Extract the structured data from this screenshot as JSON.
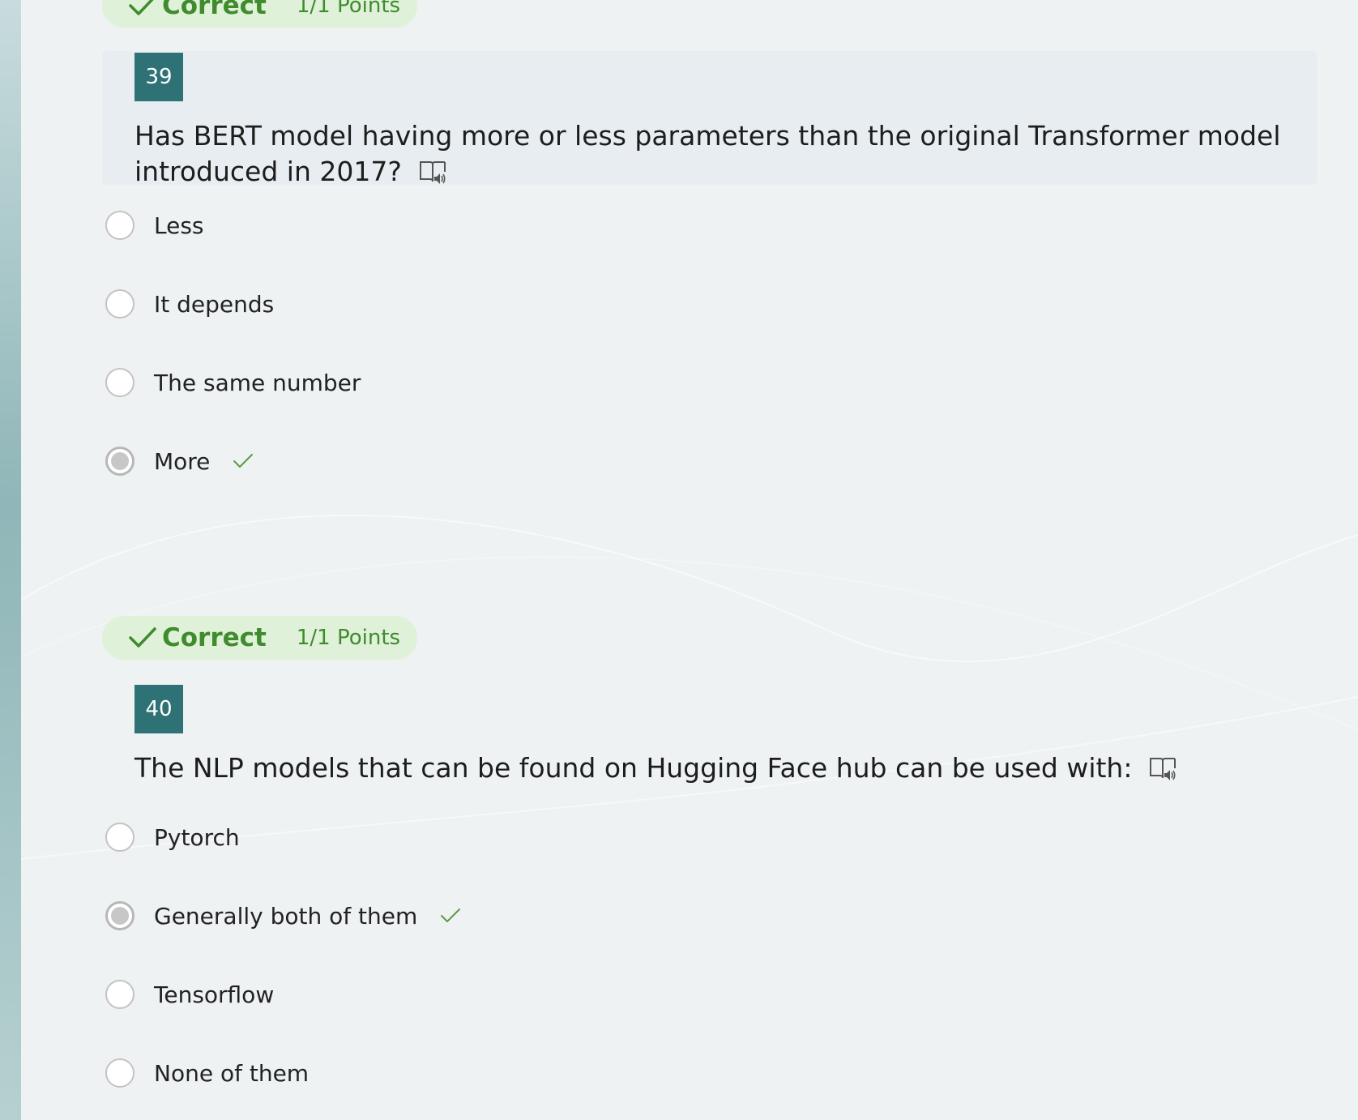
{
  "questions": [
    {
      "status": "Correct",
      "points": "1/1 Points",
      "number": "39",
      "text": "Has BERT model having more or less parameters than the original Transformer model introduced in 2017?",
      "options": [
        {
          "label": "Less",
          "selected": false
        },
        {
          "label": "It depends",
          "selected": false
        },
        {
          "label": "The same number",
          "selected": false
        },
        {
          "label": "More",
          "selected": true,
          "correct_mark": true
        }
      ]
    },
    {
      "status": "Correct",
      "points": "1/1 Points",
      "number": "40",
      "text": "The NLP models that can be found on Hugging Face hub can be used with:",
      "options": [
        {
          "label": "Pytorch",
          "selected": false
        },
        {
          "label": "Generally both of them",
          "selected": true,
          "correct_mark": true
        },
        {
          "label": "Tensorflow",
          "selected": false
        },
        {
          "label": "None of them",
          "selected": false
        }
      ]
    }
  ],
  "colors": {
    "correct_green": "#3f8b2e",
    "badge_background": "#dff1d8",
    "number_tile": "#2f7275",
    "page_background": "#eef2f3"
  },
  "icons": {
    "status": "checkmark-icon",
    "reader": "immersive-reader-icon",
    "answer": "correct-answer-check-icon"
  }
}
